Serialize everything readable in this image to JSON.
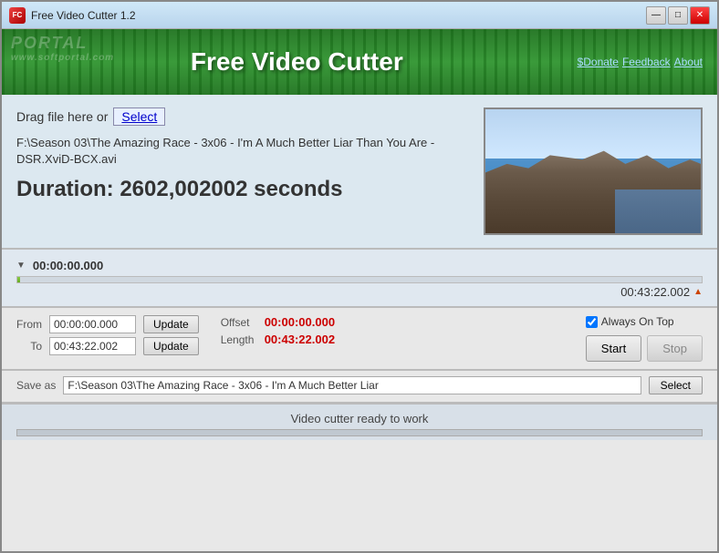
{
  "window": {
    "title": "Free Video Cutter 1.2",
    "controls": {
      "minimize": "—",
      "maximize": "□",
      "close": "✕"
    }
  },
  "banner": {
    "title": "Free Video Cutter",
    "watermark": "PORTAL",
    "watermark_sub": "www.softportal.com",
    "links": {
      "donate": "$Donate",
      "feedback": "Feedback",
      "about": "About"
    }
  },
  "top": {
    "drag_text": "Drag file here or",
    "select_label": "Select",
    "filename": "F:\\Season 03\\The Amazing Race - 3x06 - I'm A Much Better Liar Than You Are - DSR.XviD-BCX.avi",
    "duration_label": "Duration: 2602,002002 seconds"
  },
  "timeline": {
    "current_time": "00:00:00.000",
    "end_time": "00:43:22.002"
  },
  "controls": {
    "from_label": "From",
    "to_label": "To",
    "from_value": "00:00:00.000",
    "to_value": "00:43:22.002",
    "update_label": "Update",
    "offset_label": "Offset",
    "offset_value": "00:00:00.000",
    "length_label": "Length",
    "length_value": "00:43:22.002",
    "always_on_top_label": "Always On Top",
    "start_label": "Start",
    "stop_label": "Stop"
  },
  "saveas": {
    "label": "Save as",
    "value": "F:\\Season 03\\The Amazing Race - 3x06 - I'm A Much Better Liar",
    "select_label": "Select"
  },
  "status": {
    "text": "Video cutter ready to work"
  }
}
